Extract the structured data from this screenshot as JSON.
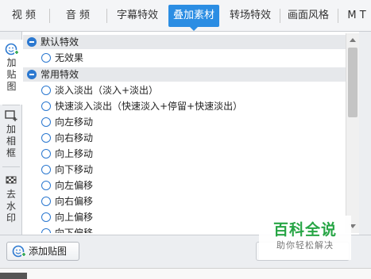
{
  "tabs": [
    {
      "label": "视  频",
      "active": false
    },
    {
      "label": "音  频",
      "active": false
    },
    {
      "label": "字幕特效",
      "active": false
    },
    {
      "label": "叠加素材",
      "active": true
    },
    {
      "label": "转场特效",
      "active": false
    },
    {
      "label": "画面风格",
      "active": false
    },
    {
      "label": "M T",
      "active": false
    }
  ],
  "side_tabs": [
    {
      "label": "加贴图",
      "icon": "add-sticker-icon",
      "active": true
    },
    {
      "label": "加相框",
      "icon": "add-frame-icon",
      "active": false
    },
    {
      "label": "去水印",
      "icon": "remove-watermark-icon",
      "active": false
    }
  ],
  "groups": [
    {
      "label": "默认特效",
      "items": [
        "无效果"
      ]
    },
    {
      "label": "常用特效",
      "items": [
        "淡入淡出（淡入+淡出）",
        "快速淡入淡出（快速淡入+停留+快速淡出）",
        "向左移动",
        "向右移动",
        "向上移动",
        "向下移动",
        "向左偏移",
        "向右偏移",
        "向上偏移",
        "向下偏移"
      ]
    }
  ],
  "bottom": {
    "add_sticker_label": "添加贴图"
  },
  "watermark": {
    "title": "百科全说",
    "subtitle": "助你轻松解决"
  },
  "colors": {
    "accent": "#2b8de3",
    "radio": "#2b78d0",
    "group_bg": "#e6e8eb",
    "watermark_green": "#27a545"
  }
}
